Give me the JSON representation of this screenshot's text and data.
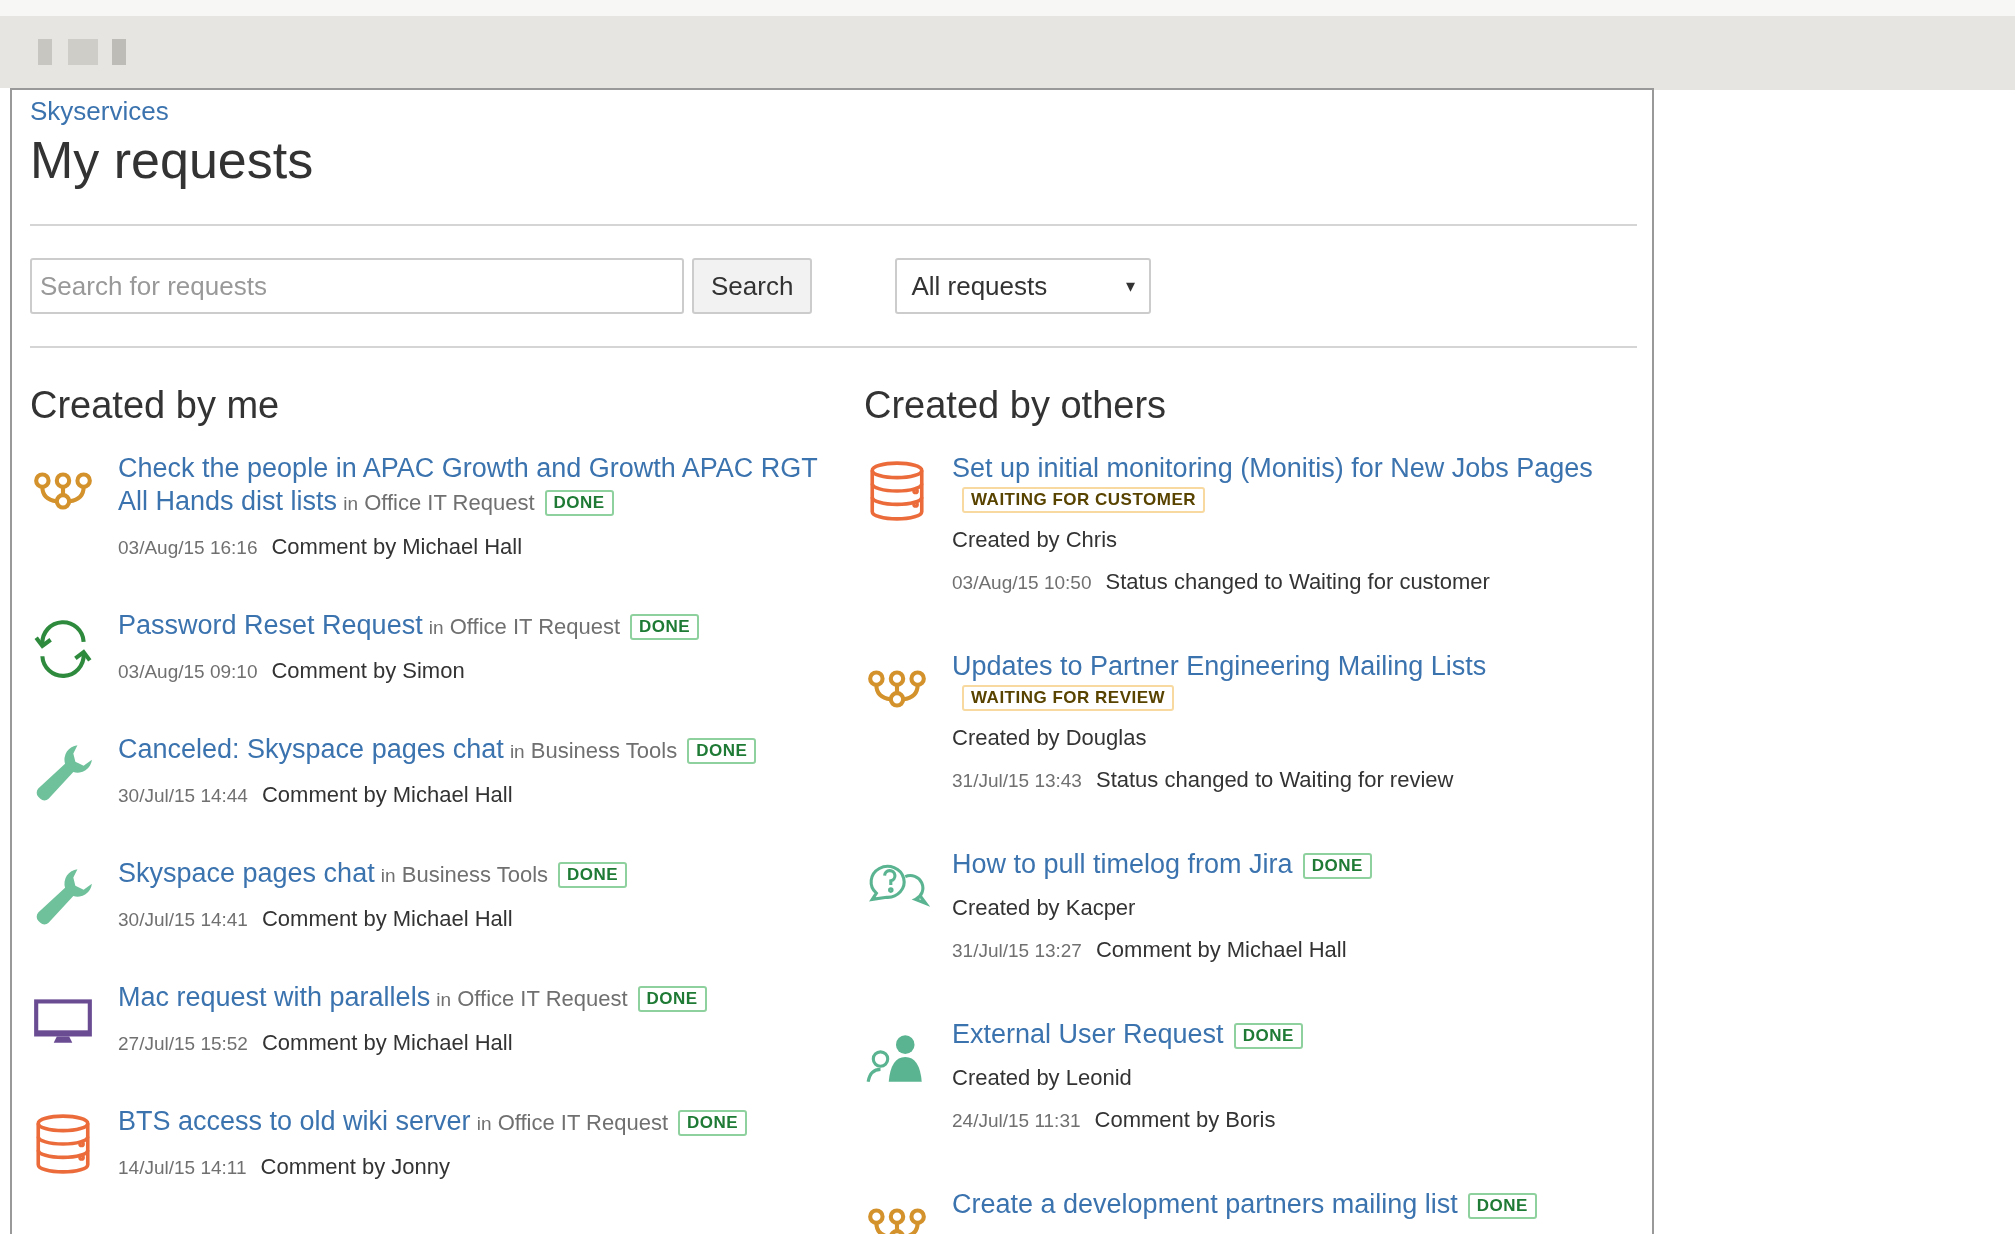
{
  "breadcrumb": "Skyservices",
  "title": "My requests",
  "search": {
    "placeholder": "Search for requests",
    "button": "Search"
  },
  "filter": {
    "value": "All requests",
    "caret": "▾"
  },
  "columns": [
    {
      "heading": "Created by me",
      "items": [
        {
          "kind": "people",
          "title_lines": [
            "Check the people in APAC Growth and Growth APAC RGT",
            "All Hands dist lists"
          ],
          "in": "in",
          "category": "Office IT Request",
          "status": {
            "text": "DONE",
            "kind": "done"
          },
          "date": "03/Aug/15 16:16",
          "activity": "Comment by Michael Hall"
        },
        {
          "kind": "sync",
          "title_lines": [
            "Password Reset Request"
          ],
          "in": "in",
          "category": "Office IT Request",
          "status": {
            "text": "DONE",
            "kind": "done"
          },
          "date": "03/Aug/15 09:10",
          "activity": "Comment by Simon"
        },
        {
          "kind": "wrench",
          "title_lines": [
            "Canceled: Skyspace pages chat"
          ],
          "in": "in",
          "category": "Business Tools",
          "status": {
            "text": "DONE",
            "kind": "done"
          },
          "date": "30/Jul/15 14:44",
          "activity": "Comment by Michael Hall"
        },
        {
          "kind": "wrench",
          "title_lines": [
            "Skyspace pages chat"
          ],
          "in": "in",
          "category": "Business Tools",
          "status": {
            "text": "DONE",
            "kind": "done"
          },
          "date": "30/Jul/15 14:41",
          "activity": "Comment by Michael Hall"
        },
        {
          "kind": "monitor",
          "title_lines": [
            "Mac request with parallels"
          ],
          "in": "in",
          "category": "Office IT Request",
          "status": {
            "text": "DONE",
            "kind": "done"
          },
          "date": "27/Jul/15 15:52",
          "activity": "Comment by Michael Hall"
        },
        {
          "kind": "database",
          "title_lines": [
            "BTS access to old wiki server"
          ],
          "in": "in",
          "category": "Office IT Request",
          "status": {
            "text": "DONE",
            "kind": "done"
          },
          "date": "14/Jul/15 14:11",
          "activity": "Comment by Jonny"
        }
      ]
    },
    {
      "heading": "Created by others",
      "items": [
        {
          "kind": "database",
          "title_lines": [
            "Set up initial monitoring (Monitis) for New Jobs Pages"
          ],
          "status": {
            "text": "WAITING FOR CUSTOMER",
            "kind": "waiting"
          },
          "creator": "Created by Chris",
          "date": "03/Aug/15 10:50",
          "activity": "Status changed to Waiting for customer"
        },
        {
          "kind": "people",
          "title_lines": [
            "Updates to Partner Engineering Mailing Lists"
          ],
          "status": {
            "text": "WAITING FOR REVIEW",
            "kind": "waiting"
          },
          "creator": "Created by Douglas",
          "date": "31/Jul/15 13:43",
          "activity": "Status changed to Waiting for review"
        },
        {
          "kind": "question",
          "title_lines": [
            "How to pull timelog from Jira"
          ],
          "status": {
            "text": "DONE",
            "kind": "done"
          },
          "creator": "Created by Kacper",
          "date": "31/Jul/15 13:27",
          "activity": "Comment by Michael Hall"
        },
        {
          "kind": "user",
          "title_lines": [
            "External User Request"
          ],
          "status": {
            "text": "DONE",
            "kind": "done"
          },
          "creator": "Created by Leonid",
          "date": "24/Jul/15 11:31",
          "activity": "Comment by Boris"
        },
        {
          "kind": "people",
          "title_lines": [
            "Create a development partners mailing list"
          ],
          "status": {
            "text": "DONE",
            "kind": "done"
          }
        }
      ]
    }
  ]
}
